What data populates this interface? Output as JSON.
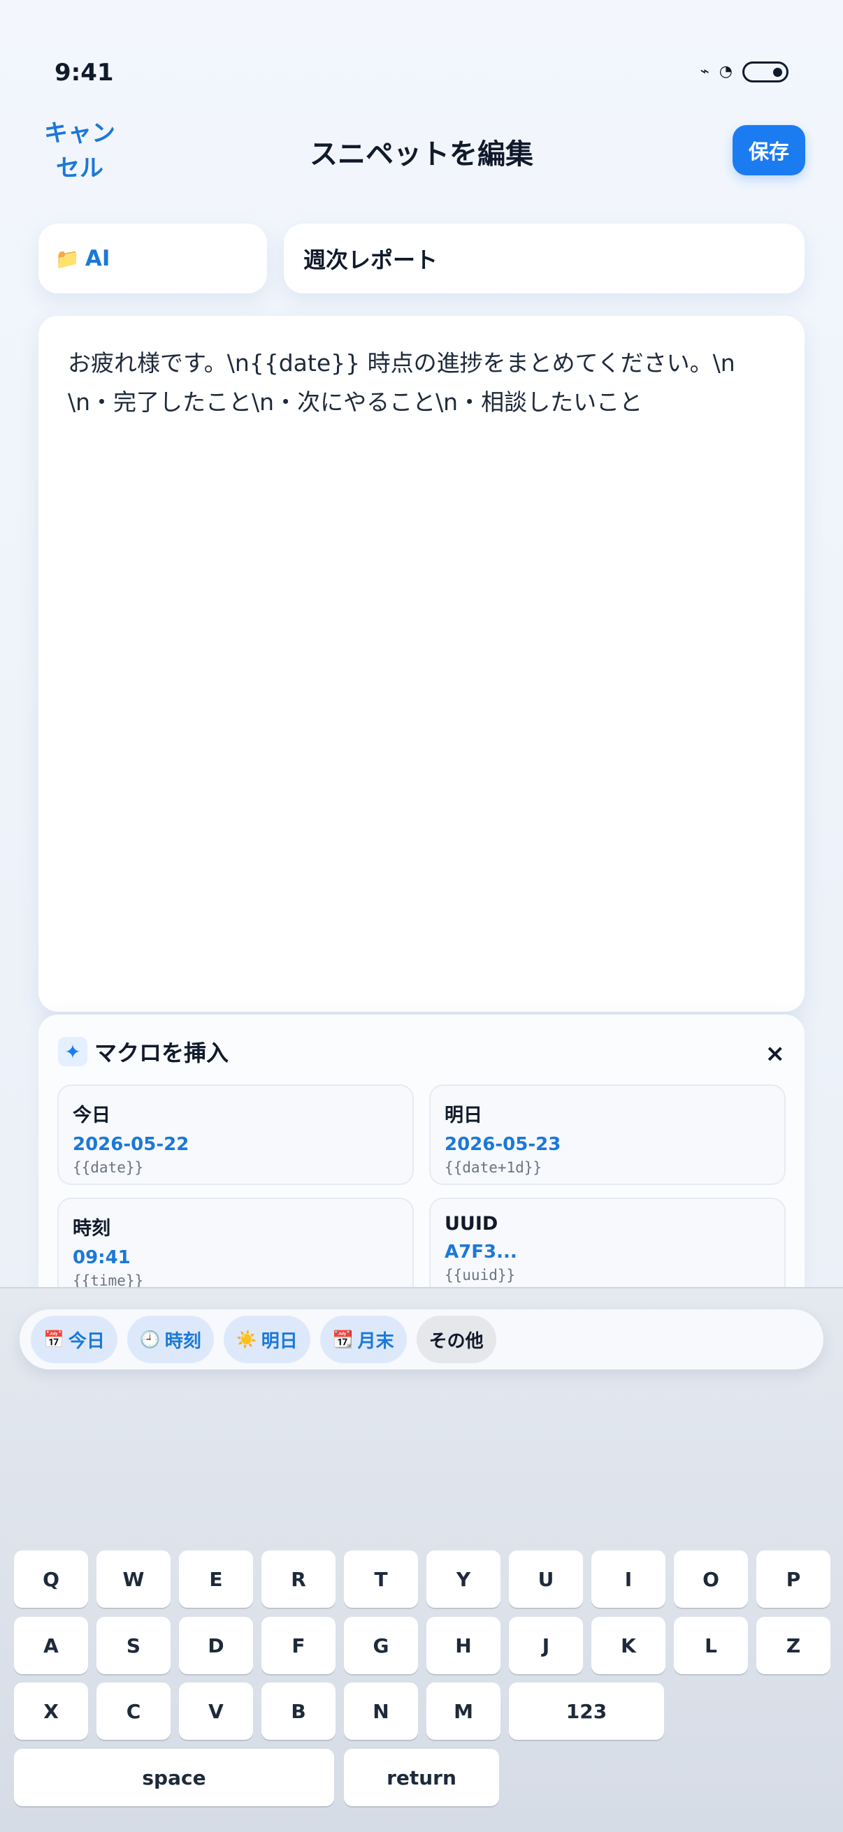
{
  "status_bar": {
    "time": "9:41",
    "icons": [
      "signal-icon",
      "clock-icon",
      "battery-icon"
    ]
  },
  "nav": {
    "cancel_label": "キャンセル",
    "title": "スニペットを編集",
    "save_label": "保存"
  },
  "folder": {
    "icon": "📁",
    "label": "AI"
  },
  "snippet_title": "週次レポート",
  "editor_text": "お疲れ様です。\\n{{date}} 時点の進捗をまとめてください。\\n\\n・完了したこと\\n・次にやること\\n・相談したいこと",
  "macro_panel": {
    "title": "マクロを挿入",
    "close_label": "×",
    "items": [
      {
        "name": "今日",
        "value": "2026-05-22",
        "code": "{{date}}"
      },
      {
        "name": "明日",
        "value": "2026-05-23",
        "code": "{{date+1d}}"
      },
      {
        "name": "時刻",
        "value": "09:41",
        "code": "{{time}}"
      },
      {
        "name": "UUID",
        "value": "A7F3...",
        "code": "{{uuid}}"
      }
    ]
  },
  "quick_chips": [
    {
      "icon": "📅",
      "label": "今日"
    },
    {
      "icon": "🕘",
      "label": "時刻"
    },
    {
      "icon": "☀️",
      "label": "明日"
    },
    {
      "icon": "📆",
      "label": "月末"
    },
    {
      "icon": "",
      "label": "その他"
    }
  ],
  "keyboard": {
    "row1": [
      "Q",
      "W",
      "E",
      "R",
      "T",
      "Y",
      "U",
      "I",
      "O",
      "P"
    ],
    "row2": [
      "A",
      "S",
      "D",
      "F",
      "G",
      "H",
      "J",
      "K",
      "L",
      "Z"
    ],
    "row3": [
      "X",
      "C",
      "V",
      "B",
      "N",
      "M"
    ],
    "numbers_label": "123",
    "space_label": "space",
    "return_label": "return"
  },
  "colors": {
    "accent": "#1b7cf2",
    "link": "#1b78d8",
    "text": "#111a2b"
  }
}
